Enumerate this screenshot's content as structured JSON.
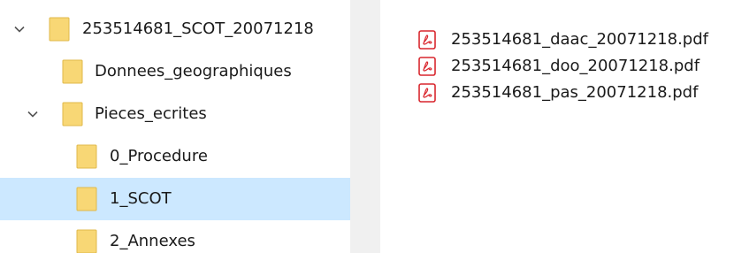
{
  "colors": {
    "selection_bg": "#cce8ff",
    "folder_yellow": "#f8d775",
    "pdf_red": "#d9272e",
    "scrollbar_track": "#f0f0f0"
  },
  "tree": {
    "items": [
      {
        "label": "253514681_SCOT_20071218",
        "expanded": true,
        "icon": "folder-icon"
      },
      {
        "label": "Donnees_geographiques",
        "expanded": false,
        "icon": "folder-icon"
      },
      {
        "label": "Pieces_ecrites",
        "expanded": true,
        "icon": "folder-icon"
      },
      {
        "label": "0_Procedure",
        "expanded": false,
        "icon": "folder-icon"
      },
      {
        "label": "1_SCOT",
        "expanded": false,
        "selected": true,
        "icon": "folder-icon"
      },
      {
        "label": "2_Annexes",
        "expanded": false,
        "icon": "folder-icon"
      }
    ]
  },
  "files": {
    "items": [
      {
        "name": "253514681_daac_20071218.pdf",
        "icon": "pdf-icon"
      },
      {
        "name": "253514681_doo_20071218.pdf",
        "icon": "pdf-icon"
      },
      {
        "name": "253514681_pas_20071218.pdf",
        "icon": "pdf-icon"
      }
    ]
  }
}
